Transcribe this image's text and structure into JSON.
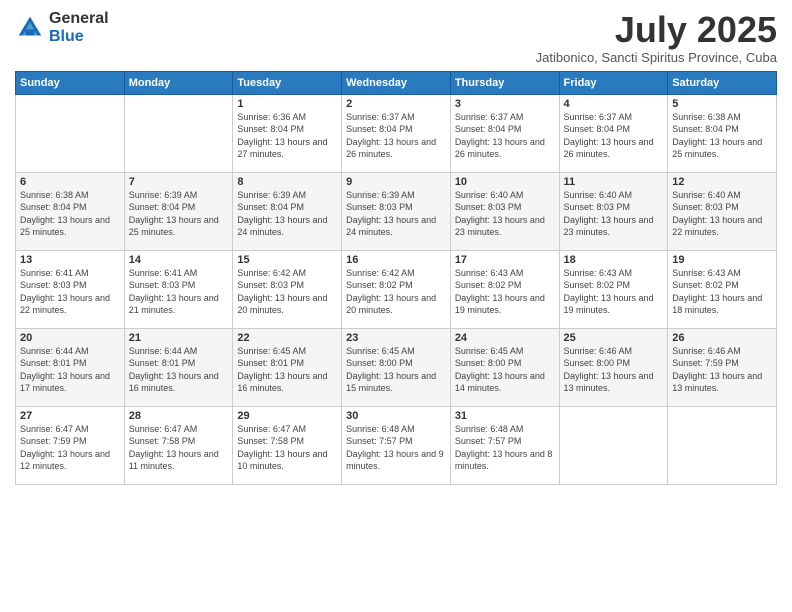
{
  "logo": {
    "general": "General",
    "blue": "Blue"
  },
  "header": {
    "title": "July 2025",
    "subtitle": "Jatibonico, Sancti Spiritus Province, Cuba"
  },
  "days_of_week": [
    "Sunday",
    "Monday",
    "Tuesday",
    "Wednesday",
    "Thursday",
    "Friday",
    "Saturday"
  ],
  "weeks": [
    [
      {
        "day": "",
        "info": ""
      },
      {
        "day": "",
        "info": ""
      },
      {
        "day": "1",
        "info": "Sunrise: 6:36 AM\nSunset: 8:04 PM\nDaylight: 13 hours and 27 minutes."
      },
      {
        "day": "2",
        "info": "Sunrise: 6:37 AM\nSunset: 8:04 PM\nDaylight: 13 hours and 26 minutes."
      },
      {
        "day": "3",
        "info": "Sunrise: 6:37 AM\nSunset: 8:04 PM\nDaylight: 13 hours and 26 minutes."
      },
      {
        "day": "4",
        "info": "Sunrise: 6:37 AM\nSunset: 8:04 PM\nDaylight: 13 hours and 26 minutes."
      },
      {
        "day": "5",
        "info": "Sunrise: 6:38 AM\nSunset: 8:04 PM\nDaylight: 13 hours and 25 minutes."
      }
    ],
    [
      {
        "day": "6",
        "info": "Sunrise: 6:38 AM\nSunset: 8:04 PM\nDaylight: 13 hours and 25 minutes."
      },
      {
        "day": "7",
        "info": "Sunrise: 6:39 AM\nSunset: 8:04 PM\nDaylight: 13 hours and 25 minutes."
      },
      {
        "day": "8",
        "info": "Sunrise: 6:39 AM\nSunset: 8:04 PM\nDaylight: 13 hours and 24 minutes."
      },
      {
        "day": "9",
        "info": "Sunrise: 6:39 AM\nSunset: 8:03 PM\nDaylight: 13 hours and 24 minutes."
      },
      {
        "day": "10",
        "info": "Sunrise: 6:40 AM\nSunset: 8:03 PM\nDaylight: 13 hours and 23 minutes."
      },
      {
        "day": "11",
        "info": "Sunrise: 6:40 AM\nSunset: 8:03 PM\nDaylight: 13 hours and 23 minutes."
      },
      {
        "day": "12",
        "info": "Sunrise: 6:40 AM\nSunset: 8:03 PM\nDaylight: 13 hours and 22 minutes."
      }
    ],
    [
      {
        "day": "13",
        "info": "Sunrise: 6:41 AM\nSunset: 8:03 PM\nDaylight: 13 hours and 22 minutes."
      },
      {
        "day": "14",
        "info": "Sunrise: 6:41 AM\nSunset: 8:03 PM\nDaylight: 13 hours and 21 minutes."
      },
      {
        "day": "15",
        "info": "Sunrise: 6:42 AM\nSunset: 8:03 PM\nDaylight: 13 hours and 20 minutes."
      },
      {
        "day": "16",
        "info": "Sunrise: 6:42 AM\nSunset: 8:02 PM\nDaylight: 13 hours and 20 minutes."
      },
      {
        "day": "17",
        "info": "Sunrise: 6:43 AM\nSunset: 8:02 PM\nDaylight: 13 hours and 19 minutes."
      },
      {
        "day": "18",
        "info": "Sunrise: 6:43 AM\nSunset: 8:02 PM\nDaylight: 13 hours and 19 minutes."
      },
      {
        "day": "19",
        "info": "Sunrise: 6:43 AM\nSunset: 8:02 PM\nDaylight: 13 hours and 18 minutes."
      }
    ],
    [
      {
        "day": "20",
        "info": "Sunrise: 6:44 AM\nSunset: 8:01 PM\nDaylight: 13 hours and 17 minutes."
      },
      {
        "day": "21",
        "info": "Sunrise: 6:44 AM\nSunset: 8:01 PM\nDaylight: 13 hours and 16 minutes."
      },
      {
        "day": "22",
        "info": "Sunrise: 6:45 AM\nSunset: 8:01 PM\nDaylight: 13 hours and 16 minutes."
      },
      {
        "day": "23",
        "info": "Sunrise: 6:45 AM\nSunset: 8:00 PM\nDaylight: 13 hours and 15 minutes."
      },
      {
        "day": "24",
        "info": "Sunrise: 6:45 AM\nSunset: 8:00 PM\nDaylight: 13 hours and 14 minutes."
      },
      {
        "day": "25",
        "info": "Sunrise: 6:46 AM\nSunset: 8:00 PM\nDaylight: 13 hours and 13 minutes."
      },
      {
        "day": "26",
        "info": "Sunrise: 6:46 AM\nSunset: 7:59 PM\nDaylight: 13 hours and 13 minutes."
      }
    ],
    [
      {
        "day": "27",
        "info": "Sunrise: 6:47 AM\nSunset: 7:59 PM\nDaylight: 13 hours and 12 minutes."
      },
      {
        "day": "28",
        "info": "Sunrise: 6:47 AM\nSunset: 7:58 PM\nDaylight: 13 hours and 11 minutes."
      },
      {
        "day": "29",
        "info": "Sunrise: 6:47 AM\nSunset: 7:58 PM\nDaylight: 13 hours and 10 minutes."
      },
      {
        "day": "30",
        "info": "Sunrise: 6:48 AM\nSunset: 7:57 PM\nDaylight: 13 hours and 9 minutes."
      },
      {
        "day": "31",
        "info": "Sunrise: 6:48 AM\nSunset: 7:57 PM\nDaylight: 13 hours and 8 minutes."
      },
      {
        "day": "",
        "info": ""
      },
      {
        "day": "",
        "info": ""
      }
    ]
  ]
}
